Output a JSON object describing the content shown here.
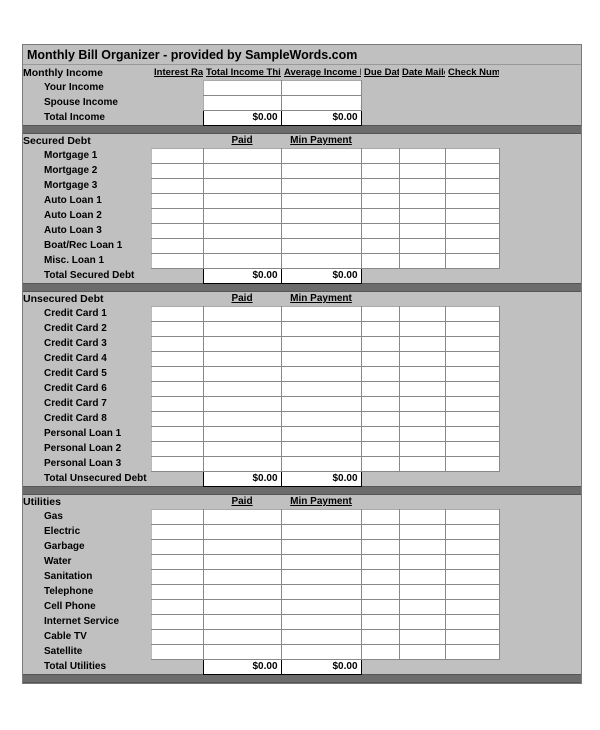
{
  "title": "Monthly Bill Organizer - provided by SampleWords.com",
  "columns": {
    "rate": "Interest Rate",
    "total_month": "Total Income This Month",
    "avg_month": "Average Income Monthly",
    "due": "Due Date",
    "mailed": "Date Mailed",
    "check": "Check Number",
    "paid": "Paid",
    "min_payment": "Min Payment"
  },
  "income": {
    "heading": "Monthly Income",
    "rows": [
      "Your Income",
      "Spouse Income"
    ],
    "total_label": "Total Income",
    "total_paid": "$0.00",
    "total_min": "$0.00"
  },
  "secured": {
    "heading": "Secured Debt",
    "rows": [
      "Mortgage 1",
      "Mortgage 2",
      "Mortgage 3",
      "Auto Loan 1",
      "Auto Loan 2",
      "Auto Loan 3",
      "Boat/Rec Loan 1",
      "Misc. Loan 1"
    ],
    "total_label": "Total Secured Debt",
    "total_paid": "$0.00",
    "total_min": "$0.00"
  },
  "unsecured": {
    "heading": "Unsecured Debt",
    "rows": [
      "Credit Card 1",
      "Credit Card 2",
      "Credit Card 3",
      "Credit Card 4",
      "Credit Card 5",
      "Credit Card 6",
      "Credit Card 7",
      "Credit Card 8",
      "Personal Loan 1",
      "Personal Loan 2",
      "Personal Loan 3"
    ],
    "total_label": "Total Unsecured Debt",
    "total_paid": "$0.00",
    "total_min": "$0.00"
  },
  "utilities": {
    "heading": "Utilities",
    "rows": [
      "Gas",
      "Electric",
      "Garbage",
      "Water",
      "Sanitation",
      "Telephone",
      "Cell Phone",
      "Internet Service",
      "Cable TV",
      "Satellite"
    ],
    "total_label": "Total Utilities",
    "total_paid": "$0.00",
    "total_min": "$0.00"
  }
}
